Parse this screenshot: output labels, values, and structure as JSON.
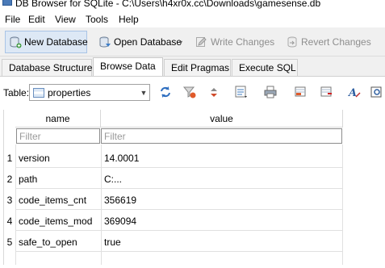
{
  "window": {
    "title": "DB Browser for SQLite - C:\\Users\\h4xr0x.cc\\Downloads\\gamesense.db"
  },
  "menubar": {
    "items": [
      "File",
      "Edit",
      "View",
      "Tools",
      "Help"
    ]
  },
  "toolbar": {
    "new_database": "New Database",
    "open_database": "Open Database",
    "write_changes": "Write Changes",
    "revert_changes": "Revert Changes"
  },
  "tabs": {
    "items": [
      "Database Structure",
      "Browse Data",
      "Edit Pragmas",
      "Execute SQL"
    ],
    "active": "Browse Data"
  },
  "browse": {
    "table_label": "Table:",
    "table_selected": "properties",
    "columns": [
      "name",
      "value"
    ],
    "filter_placeholder": "Filter",
    "rows": [
      {
        "num": "1",
        "name": "version",
        "value": "14.0001"
      },
      {
        "num": "2",
        "name": "path",
        "value": "C:..."
      },
      {
        "num": "3",
        "name": "code_items_cnt",
        "value": "356619"
      },
      {
        "num": "4",
        "name": "code_items_mod",
        "value": "369094"
      },
      {
        "num": "5",
        "name": "safe_to_open",
        "value": "true"
      }
    ]
  },
  "icons": [
    "app-icon",
    "new-database-icon",
    "open-database-icon",
    "write-changes-icon",
    "revert-changes-icon",
    "refresh-icon",
    "clear-filters-icon",
    "sort-icon",
    "save-table-icon",
    "print-icon",
    "new-record-icon",
    "delete-record-icon",
    "font-icon",
    "find-icon"
  ]
}
